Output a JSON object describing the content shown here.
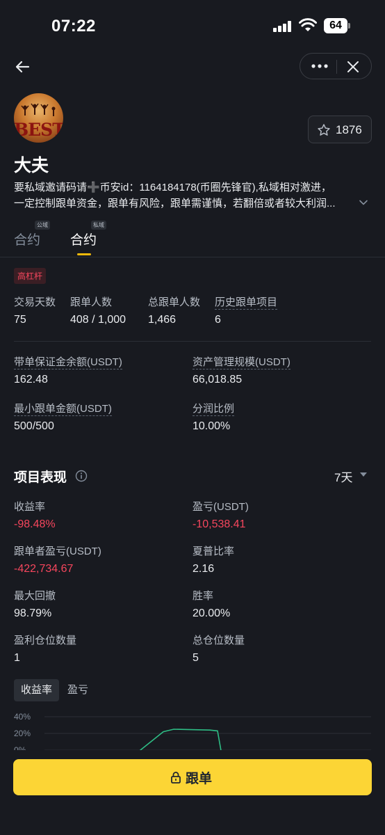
{
  "status_bar": {
    "time": "07:22",
    "battery": "64"
  },
  "profile": {
    "avatar_text": "BEST",
    "name": "大夫",
    "favorites": "1876",
    "bio_line1": "要私域邀请码请➕币安id：1164184178(币圈先锋官),私域相对激进，",
    "bio_line2": "一定控制跟单资金，跟单有风险，跟单需谨慎，若翻倍或者较大利润..."
  },
  "tabs": [
    {
      "label": "合约",
      "badge": "公域"
    },
    {
      "label": "合约",
      "badge": "私域"
    }
  ],
  "tag": "高杠杆",
  "summary": [
    {
      "label": "交易天数",
      "value": "75"
    },
    {
      "label": "跟单人数",
      "value": "408 / 1,000"
    },
    {
      "label": "总跟单人数",
      "value": "1,466"
    },
    {
      "label": "历史跟单项目",
      "value": "6"
    }
  ],
  "account": [
    {
      "label": "带单保证金余额(USDT)",
      "value": "162.48"
    },
    {
      "label": "资产管理规模(USDT)",
      "value": "66,018.85"
    },
    {
      "label": "最小跟单金额(USDT)",
      "value": "500/500"
    },
    {
      "label": "分润比例",
      "value": "10.00%"
    }
  ],
  "performance": {
    "title": "项目表现",
    "period": "7天",
    "metrics": [
      {
        "label": "收益率",
        "value": "-98.48%"
      },
      {
        "label": "盈亏(USDT)",
        "value": "-10,538.41"
      },
      {
        "label": "跟单者盈亏(USDT)",
        "value": "-422,734.67"
      },
      {
        "label": "夏普比率",
        "value": "2.16"
      },
      {
        "label": "最大回撤",
        "value": "98.79%"
      },
      {
        "label": "胜率",
        "value": "20.00%"
      },
      {
        "label": "盈利仓位数量",
        "value": "1"
      },
      {
        "label": "总仓位数量",
        "value": "5"
      }
    ]
  },
  "chart_tabs": {
    "active": "收益率",
    "inactive": "盈亏"
  },
  "chart_data": {
    "type": "line",
    "ytick_labels": [
      "40%",
      "20%",
      "0%"
    ],
    "ylim": [
      0,
      40
    ],
    "series": [
      {
        "values": [
          -8,
          22,
          25,
          24,
          23,
          -10
        ]
      }
    ],
    "color": "#2ebd85"
  },
  "colors": {
    "accent": "#fcd535",
    "negative": "#f6465d",
    "positive": "#2ebd85"
  },
  "follow_button": "跟单"
}
